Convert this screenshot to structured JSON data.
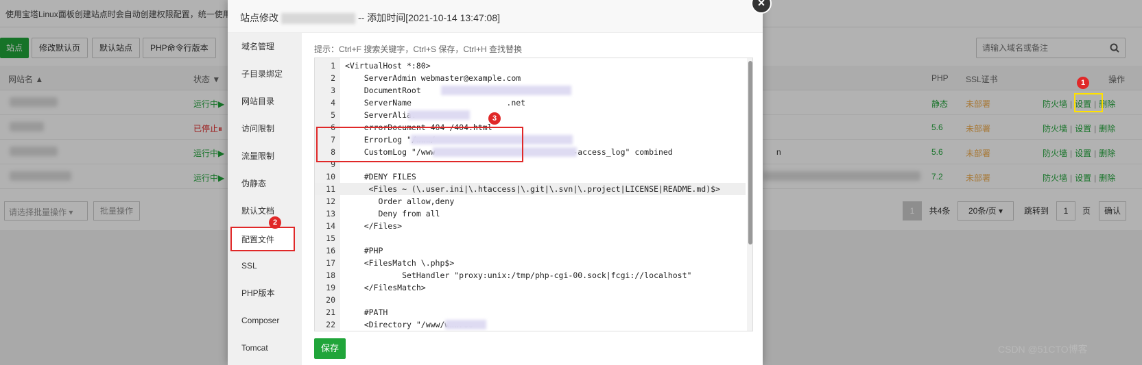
{
  "background": {
    "notice": "使用宝塔Linux面板创建站点时会自动创建权限配置，统一使用",
    "toolbar": {
      "add_site": "站点",
      "modify_default": "修改默认页",
      "default_site": "默认站点",
      "php_cli": "PHP命令行版本",
      "search_placeholder": "请输入域名或备注"
    },
    "table_headers": {
      "site_name": "网站名 ▲",
      "status": "状态 ▼",
      "php": "PHP",
      "ssl": "SSL证书",
      "action": "操作"
    },
    "rows": [
      {
        "status": "运行中▶",
        "php": "静态",
        "ssl": "未部署",
        "firewall": "防火墙",
        "settings": "设置",
        "delete": "删除"
      },
      {
        "status": "已停止⏸",
        "php": "5.6",
        "ssl": "未部署",
        "firewall": "防火墙",
        "settings": "设置",
        "delete": "删除"
      },
      {
        "status": "运行中▶",
        "php": "5.6",
        "ssl": "未部署",
        "firewall": "防火墙",
        "settings": "设置",
        "delete": "删除",
        "extra": "n"
      },
      {
        "status": "运行中▶",
        "php": "7.2",
        "ssl": "未部署",
        "firewall": "防火墙",
        "settings": "设置",
        "delete": "删除"
      }
    ],
    "footer": {
      "batch_select": "请选择批量操作",
      "batch_btn": "批量操作",
      "page_current": "1",
      "total": "共4条",
      "per_page": "20条/页",
      "jump_to": "跳转到",
      "jump_page": "1",
      "page_unit": "页",
      "confirm": "确认"
    }
  },
  "modal": {
    "title_prefix": "站点修改",
    "title_suffix": "-- 添加时间[2021-10-14 13:47:08]",
    "close": "×",
    "sidebar": [
      "域名管理",
      "子目录绑定",
      "网站目录",
      "访问限制",
      "流量限制",
      "伪静态",
      "默认文档",
      "配置文件",
      "SSL",
      "PHP版本",
      "Composer",
      "Tomcat"
    ],
    "hint": "提示：Ctrl+F 搜索关键字，Ctrl+S 保存，Ctrl+H 查找替换",
    "code_lines": [
      {
        "n": "1",
        "text": "<VirtualHost *:80>"
      },
      {
        "n": "2",
        "text": "    ServerAdmin webmaster@example.com"
      },
      {
        "n": "3",
        "text": "    DocumentRoot"
      },
      {
        "n": "4",
        "text": "    ServerName                    .net"
      },
      {
        "n": "5",
        "text": "    ServerAlia."
      },
      {
        "n": "6",
        "text": "    errorDocument 404 /404.html"
      },
      {
        "n": "7",
        "text": "    ErrorLog \"/www/"
      },
      {
        "n": "8",
        "text": "    CustomLog \"/www                             -access_log\" combined"
      },
      {
        "n": "9",
        "text": ""
      },
      {
        "n": "10",
        "text": "    #DENY FILES"
      },
      {
        "n": "11",
        "text": "     <Files ~ (\\.user.ini|\\.htaccess|\\.git|\\.svn|\\.project|LICENSE|README.md)$>"
      },
      {
        "n": "12",
        "text": "       Order allow,deny"
      },
      {
        "n": "13",
        "text": "       Deny from all"
      },
      {
        "n": "14",
        "text": "    </Files>"
      },
      {
        "n": "15",
        "text": ""
      },
      {
        "n": "16",
        "text": "    #PHP"
      },
      {
        "n": "17",
        "text": "    <FilesMatch \\.php$>"
      },
      {
        "n": "18",
        "text": "            SetHandler \"proxy:unix:/tmp/php-cgi-00.sock|fcgi://localhost\""
      },
      {
        "n": "19",
        "text": "    </FilesMatch>"
      },
      {
        "n": "20",
        "text": ""
      },
      {
        "n": "21",
        "text": "    #PATH"
      },
      {
        "n": "22",
        "text": "    <Directory \"/www/wwwroo"
      }
    ],
    "save": "保存"
  },
  "badges": [
    "1",
    "2",
    "3"
  ],
  "watermark": "CSDN @51CTO博客",
  "colors": {
    "accent": "#20a53a",
    "danger": "#e02828",
    "warning": "#f0ad4e",
    "highlight": "#ffe100"
  }
}
